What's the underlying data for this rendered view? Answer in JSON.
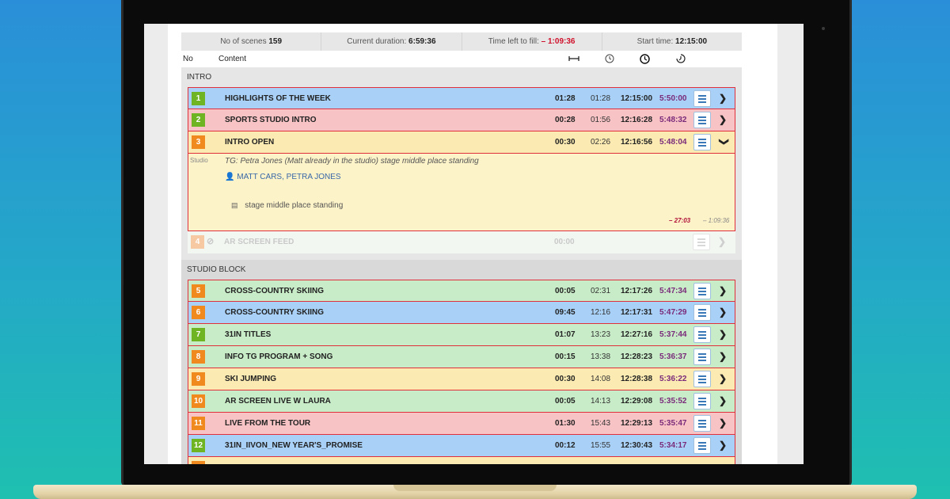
{
  "summary": {
    "scenes_label": "No of scenes",
    "scenes_value": "159",
    "duration_label": "Current duration:",
    "duration_value": "6:59:36",
    "left_label": "Time left to fill:",
    "left_value": "– 1:09:36",
    "start_label": "Start time:",
    "start_value": "12:15:00"
  },
  "columns": {
    "no": "No",
    "content": "Content",
    "icons": [
      "duration-icon",
      "cumulative-time-icon",
      "clock-icon",
      "countdown-icon"
    ]
  },
  "sections": [
    {
      "title": "INTRO",
      "rows": [
        {
          "num": "1",
          "title": "HIGHLIGHTS OF THE WEEK",
          "t1": "01:28",
          "t2": "01:28",
          "t3": "12:15:00",
          "t4": "5:50:00"
        },
        {
          "num": "2",
          "title": "SPORTS STUDIO INTRO",
          "t1": "00:28",
          "t2": "01:56",
          "t3": "12:16:28",
          "t4": "5:48:32"
        },
        {
          "num": "3",
          "title": "INTRO OPEN",
          "t1": "00:30",
          "t2": "02:26",
          "t3": "12:16:56",
          "t4": "5:48:04"
        },
        {
          "num": "4",
          "title": "AR SCREEN FEED",
          "t1": "00:00"
        }
      ],
      "expanded": {
        "label": "Studio",
        "description": "TG: Petra Jones (Matt already in the studio) stage middle place standing",
        "people": "MATT CARS, PETRA JONES",
        "note": "stage middle place standing",
        "time_a": "– 27:03",
        "time_b": "– 1:09:36"
      }
    },
    {
      "title": "STUDIO BLOCK",
      "rows": [
        {
          "num": "5",
          "title": "CROSS-COUNTRY SKIING",
          "t1": "00:05",
          "t2": "02:31",
          "t3": "12:17:26",
          "t4": "5:47:34"
        },
        {
          "num": "6",
          "title": "CROSS-COUNTRY SKIING",
          "t1": "09:45",
          "t2": "12:16",
          "t3": "12:17:31",
          "t4": "5:47:29"
        },
        {
          "num": "7",
          "title": "31IN TITLES",
          "t1": "01:07",
          "t2": "13:23",
          "t3": "12:27:16",
          "t4": "5:37:44"
        },
        {
          "num": "8",
          "title": "INFO TG PROGRAM + SONG",
          "t1": "00:15",
          "t2": "13:38",
          "t3": "12:28:23",
          "t4": "5:36:37"
        },
        {
          "num": "9",
          "title": "SKI JUMPING",
          "t1": "00:30",
          "t2": "14:08",
          "t3": "12:28:38",
          "t4": "5:36:22"
        },
        {
          "num": "10",
          "title": "AR SCREEN LIVE W LAURA",
          "t1": "00:05",
          "t2": "14:13",
          "t3": "12:29:08",
          "t4": "5:35:52"
        },
        {
          "num": "11",
          "title": "LIVE FROM THE TOUR",
          "t1": "01:30",
          "t2": "15:43",
          "t3": "12:29:13",
          "t4": "5:35:47"
        },
        {
          "num": "12",
          "title": "31IN_IIVON_NEW YEAR'S_PROMISE",
          "t1": "00:12",
          "t2": "15:55",
          "t3": "12:30:43",
          "t4": "5:34:17"
        }
      ]
    }
  ],
  "colors": {
    "blue_row": "#a9d1f7",
    "red_row": "#f8c3c5",
    "yellow_row": "#fbeab2",
    "green_row": "#c8ecc8",
    "green_num": "#6fb523",
    "orange_num": "#f08a1e",
    "border": "#e0303c",
    "negative": "#d0112b"
  }
}
